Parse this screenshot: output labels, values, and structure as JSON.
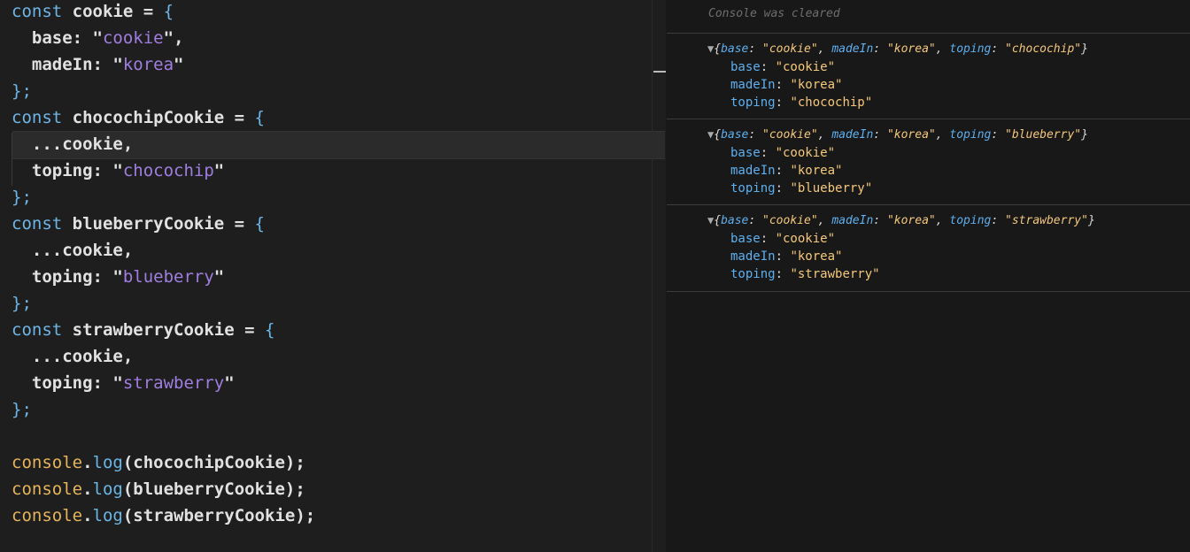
{
  "editor": {
    "lines": {
      "l1_kw": "const",
      "l1_rest": " cookie = ",
      "l1_brace": "{",
      "l2_key": "  base: ",
      "l2_val": "cookie",
      "l2_tail": ",",
      "l3_key": "  madeIn: ",
      "l3_val": "korea",
      "l4": "};",
      "l5_kw": "const",
      "l5_rest": " chocochipCookie = ",
      "l5_brace": "{",
      "l6": "  ...cookie,",
      "l7_key": "  toping: ",
      "l7_val": "chocochip",
      "l8": "};",
      "l9_kw": "const",
      "l9_rest": " blueberryCookie = ",
      "l9_brace": "{",
      "l10": "  ...cookie,",
      "l11_key": "  toping: ",
      "l11_val": "blueberry",
      "l12": "};",
      "l13_kw": "const",
      "l13_rest": " strawberryCookie = ",
      "l13_brace": "{",
      "l14": "  ...cookie,",
      "l15_key": "  toping: ",
      "l15_val": "strawberry",
      "l16": "};",
      "l18_obj": "console",
      "l18_fn": "log",
      "l18_arg": "(chocochipCookie);",
      "l19_obj": "console",
      "l19_fn": "log",
      "l19_arg": "(blueberryCookie);",
      "l20_obj": "console",
      "l20_fn": "log",
      "l20_arg": "(strawberryCookie);"
    }
  },
  "console": {
    "cleared_text": "Console was cleared",
    "entries": [
      {
        "summary_base": "\"cookie\"",
        "summary_madein": "\"korea\"",
        "summary_toping": "\"chocochip\"",
        "base": "\"cookie\"",
        "madein": "\"korea\"",
        "toping": "\"chocochip\""
      },
      {
        "summary_base": "\"cookie\"",
        "summary_madein": "\"korea\"",
        "summary_toping": "\"blueberry\"",
        "base": "\"cookie\"",
        "madein": "\"korea\"",
        "toping": "\"blueberry\""
      },
      {
        "summary_base": "\"cookie\"",
        "summary_madein": "\"korea\"",
        "summary_toping": "\"strawberry\"",
        "base": "\"cookie\"",
        "madein": "\"korea\"",
        "toping": "\"strawberry\""
      }
    ],
    "labels": {
      "base": "base",
      "madein": "madeIn",
      "toping": "toping",
      "expand": "▼"
    }
  }
}
